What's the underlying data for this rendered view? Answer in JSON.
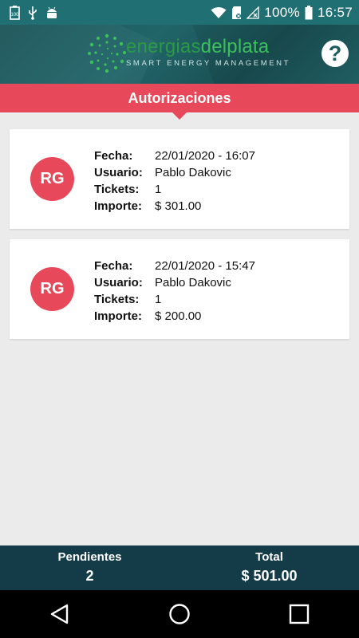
{
  "status_bar": {
    "battery_percent": "100%",
    "time": "16:57",
    "icons_left": [
      "battery-100-icon",
      "usb-icon",
      "android-icon"
    ],
    "icons_right": [
      "wifi-icon",
      "sd-card-icon",
      "no-signal-icon",
      "battery-icon"
    ]
  },
  "header": {
    "logo": {
      "brand_part1": "energias",
      "brand_part2": "delplata",
      "tagline": "SMART ENERGY MANAGEMENT"
    },
    "help_label": "?"
  },
  "page": {
    "title": "Autorizaciones"
  },
  "labels": {
    "fecha": "Fecha:",
    "usuario": "Usuario:",
    "tickets": "Tickets:",
    "importe": "Importe:"
  },
  "authorizations": [
    {
      "initials": "RG",
      "fecha": "22/01/2020 - 16:07",
      "usuario": "Pablo Dakovic",
      "tickets": "1",
      "importe": "$ 301.00"
    },
    {
      "initials": "RG",
      "fecha": "22/01/2020 - 15:47",
      "usuario": "Pablo Dakovic",
      "tickets": "1",
      "importe": "$ 200.00"
    }
  ],
  "summary": {
    "pending_label": "Pendientes",
    "pending_value": "2",
    "total_label": "Total",
    "total_value": "$ 501.00"
  },
  "colors": {
    "accent": "#e8495a",
    "header_teal": "#1f6f73",
    "summary_bg": "#143c48",
    "brand_green": "#2bb24c"
  }
}
